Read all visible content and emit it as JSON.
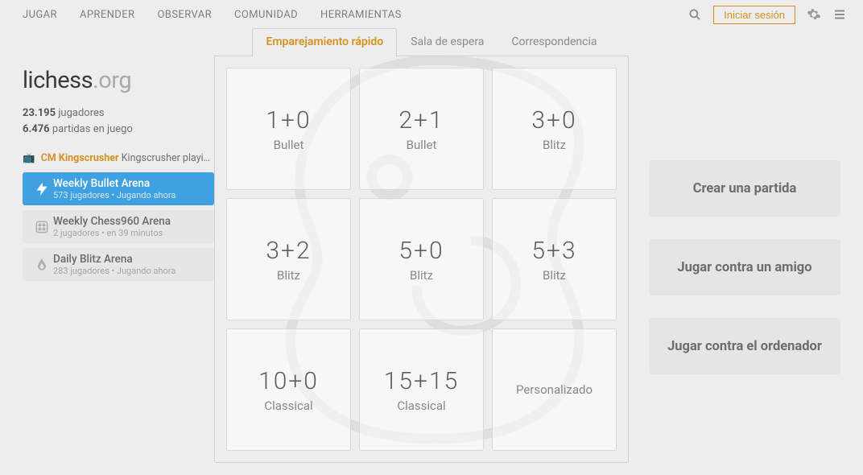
{
  "nav": {
    "items": [
      "JUGAR",
      "APRENDER",
      "OBSERVAR",
      "COMUNIDAD",
      "HERRAMIENTAS"
    ],
    "signin": "Iniciar sesión"
  },
  "tabs": [
    {
      "label": "Emparejamiento rápido",
      "active": true
    },
    {
      "label": "Sala de espera",
      "active": false
    },
    {
      "label": "Correspondencia",
      "active": false
    }
  ],
  "logo": {
    "name": "lichess",
    "tld": ".org"
  },
  "stats": {
    "players_n": "23.195",
    "players_label": "jugadores",
    "games_n": "6.476",
    "games_label": "partidas en juego"
  },
  "streamer": {
    "title_badge": "CM",
    "name": "Kingscrusher",
    "desc": "Kingscrusher playing o..."
  },
  "events": [
    {
      "icon": "bolt",
      "title": "Weekly Bullet Arena",
      "sub": "573 jugadores • Jugando ahora",
      "active": true
    },
    {
      "icon": "die",
      "title": "Weekly Chess960 Arena",
      "sub": "2 jugadores •  en 39 minutos",
      "active": false
    },
    {
      "icon": "flame",
      "title": "Daily Blitz Arena",
      "sub": "283 jugadores • Jugando ahora",
      "active": false
    }
  ],
  "tiles": [
    {
      "time": "1+0",
      "type": "Bullet"
    },
    {
      "time": "2+1",
      "type": "Bullet"
    },
    {
      "time": "3+0",
      "type": "Blitz"
    },
    {
      "time": "3+2",
      "type": "Blitz"
    },
    {
      "time": "5+0",
      "type": "Blitz"
    },
    {
      "time": "5+3",
      "type": "Blitz"
    },
    {
      "time": "10+0",
      "type": "Classical"
    },
    {
      "time": "15+15",
      "type": "Classical"
    },
    {
      "custom": "Personalizado"
    }
  ],
  "actions": {
    "create": "Crear una partida",
    "friend": "Jugar contra un amigo",
    "computer": "Jugar contra el ordenador"
  },
  "colors": {
    "accent": "#d59120",
    "highlight": "#3fa1e0"
  }
}
